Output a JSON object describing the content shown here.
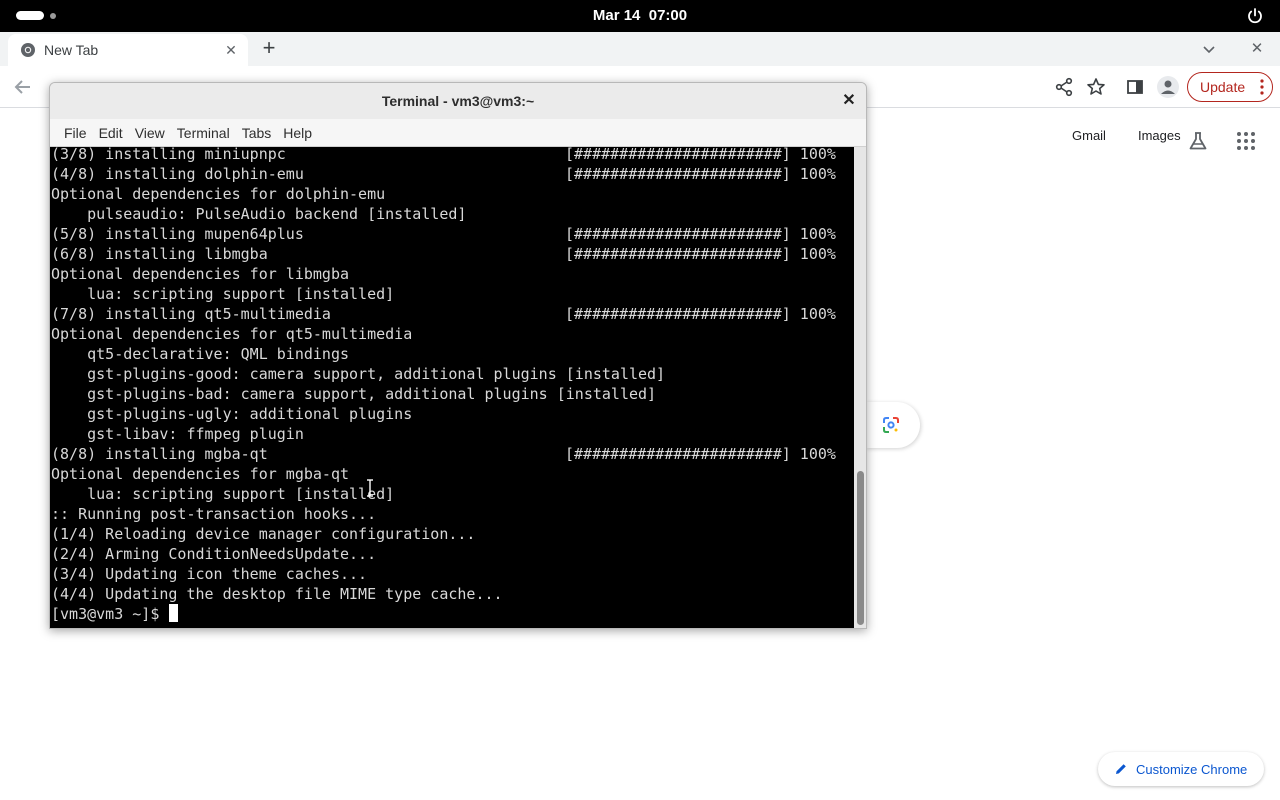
{
  "topbar": {
    "date": "Mar 14",
    "time": "07:00"
  },
  "chrome": {
    "tab_title": "New Tab",
    "update_label": "Update",
    "links": [
      "Gmail",
      "Images"
    ],
    "customize_label": "Customize Chrome"
  },
  "terminal": {
    "title": "Terminal - vm3@vm3:~",
    "menu": [
      "File",
      "Edit",
      "View",
      "Terminal",
      "Tabs",
      "Help"
    ],
    "progress_text": "[#######################] 100%",
    "lines": [
      {
        "text": "(3/8) installing miniupnpc",
        "progress": true
      },
      {
        "text": "(4/8) installing dolphin-emu",
        "progress": true
      },
      {
        "text": "Optional dependencies for dolphin-emu",
        "progress": false
      },
      {
        "text": "    pulseaudio: PulseAudio backend [installed]",
        "progress": false
      },
      {
        "text": "(5/8) installing mupen64plus",
        "progress": true
      },
      {
        "text": "(6/8) installing libmgba",
        "progress": true
      },
      {
        "text": "Optional dependencies for libmgba",
        "progress": false
      },
      {
        "text": "    lua: scripting support [installed]",
        "progress": false
      },
      {
        "text": "(7/8) installing qt5-multimedia",
        "progress": true
      },
      {
        "text": "Optional dependencies for qt5-multimedia",
        "progress": false
      },
      {
        "text": "    qt5-declarative: QML bindings",
        "progress": false
      },
      {
        "text": "    gst-plugins-good: camera support, additional plugins [installed]",
        "progress": false
      },
      {
        "text": "    gst-plugins-bad: camera support, additional plugins [installed]",
        "progress": false
      },
      {
        "text": "    gst-plugins-ugly: additional plugins",
        "progress": false
      },
      {
        "text": "    gst-libav: ffmpeg plugin",
        "progress": false
      },
      {
        "text": "(8/8) installing mgba-qt",
        "progress": true
      },
      {
        "text": "Optional dependencies for mgba-qt",
        "progress": false
      },
      {
        "text": "    lua: scripting support [installed]",
        "progress": false
      },
      {
        "text": ":: Running post-transaction hooks...",
        "progress": false
      },
      {
        "text": "(1/4) Reloading device manager configuration...",
        "progress": false
      },
      {
        "text": "(2/4) Arming ConditionNeedsUpdate...",
        "progress": false
      },
      {
        "text": "(3/4) Updating icon theme caches...",
        "progress": false
      },
      {
        "text": "(4/4) Updating the desktop file MIME type cache...",
        "progress": false
      }
    ],
    "prompt": "[vm3@vm3 ~]$ "
  }
}
